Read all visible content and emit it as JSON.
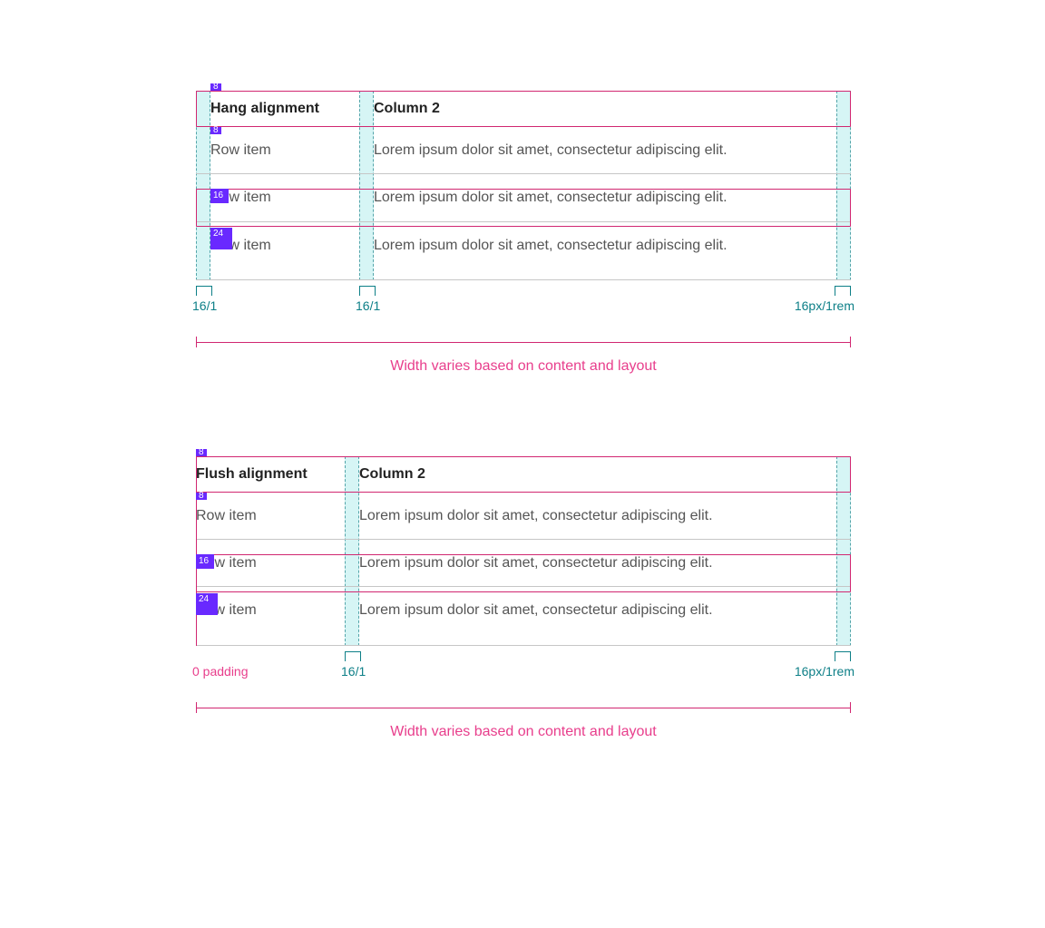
{
  "figures": {
    "hang": {
      "headers": {
        "c1": "Hang alignment",
        "c2": "Column 2"
      },
      "rows": [
        {
          "c1": "Row item",
          "c2": "Lorem ipsum dolor sit amet, consectetur adipiscing elit."
        },
        {
          "c1": "Row item",
          "c2": "Lorem ipsum dolor sit amet, consectetur adipiscing elit."
        },
        {
          "c1": "Row item",
          "c2": "Lorem ipsum dolor sit amet, consectetur adipiscing elit."
        }
      ],
      "chips": {
        "top": "8",
        "below_header": "8",
        "mid": "16",
        "tall": "24"
      },
      "gutter_labels": {
        "left": "16/1",
        "mid": "16/1",
        "right": "16px/1rem"
      },
      "caption": "Width varies based on content and layout"
    },
    "flush": {
      "headers": {
        "c1": "Flush alignment",
        "c2": "Column 2"
      },
      "rows": [
        {
          "c1": "Row item",
          "c2": "Lorem ipsum dolor sit amet, consectetur adipiscing elit."
        },
        {
          "c1": "Row item",
          "c2": "Lorem ipsum dolor sit amet, consectetur adipiscing elit."
        },
        {
          "c1": "Row item",
          "c2": "Lorem ipsum dolor sit amet, consectetur adipiscing elit."
        }
      ],
      "chips": {
        "top": "8",
        "below_header": "8",
        "mid": "16",
        "tall": "24"
      },
      "gutter_labels": {
        "left": "0 padding",
        "mid": "16/1",
        "right": "16px/1rem"
      },
      "caption": "Width varies based on content and layout"
    }
  }
}
